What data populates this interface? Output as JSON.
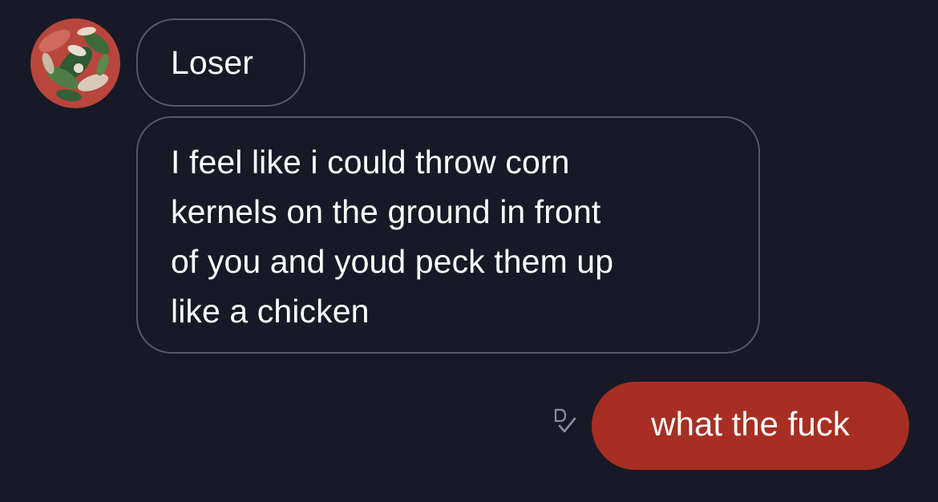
{
  "conversation": {
    "incoming": [
      {
        "text": "Loser"
      },
      {
        "text": "I feel like i could throw corn\nkernels on the ground in front\nof you and youd peck them up\nlike a chicken"
      }
    ],
    "outgoing": [
      {
        "text": "what the fuck",
        "status_icon": "seen-check-icon"
      }
    ]
  },
  "colors": {
    "background": "#171a26",
    "incoming_border": "#565a67",
    "outgoing_bubble": "#a72e22"
  },
  "icons": {
    "avatar": "profile-avatar",
    "status": "seen-check-icon"
  }
}
